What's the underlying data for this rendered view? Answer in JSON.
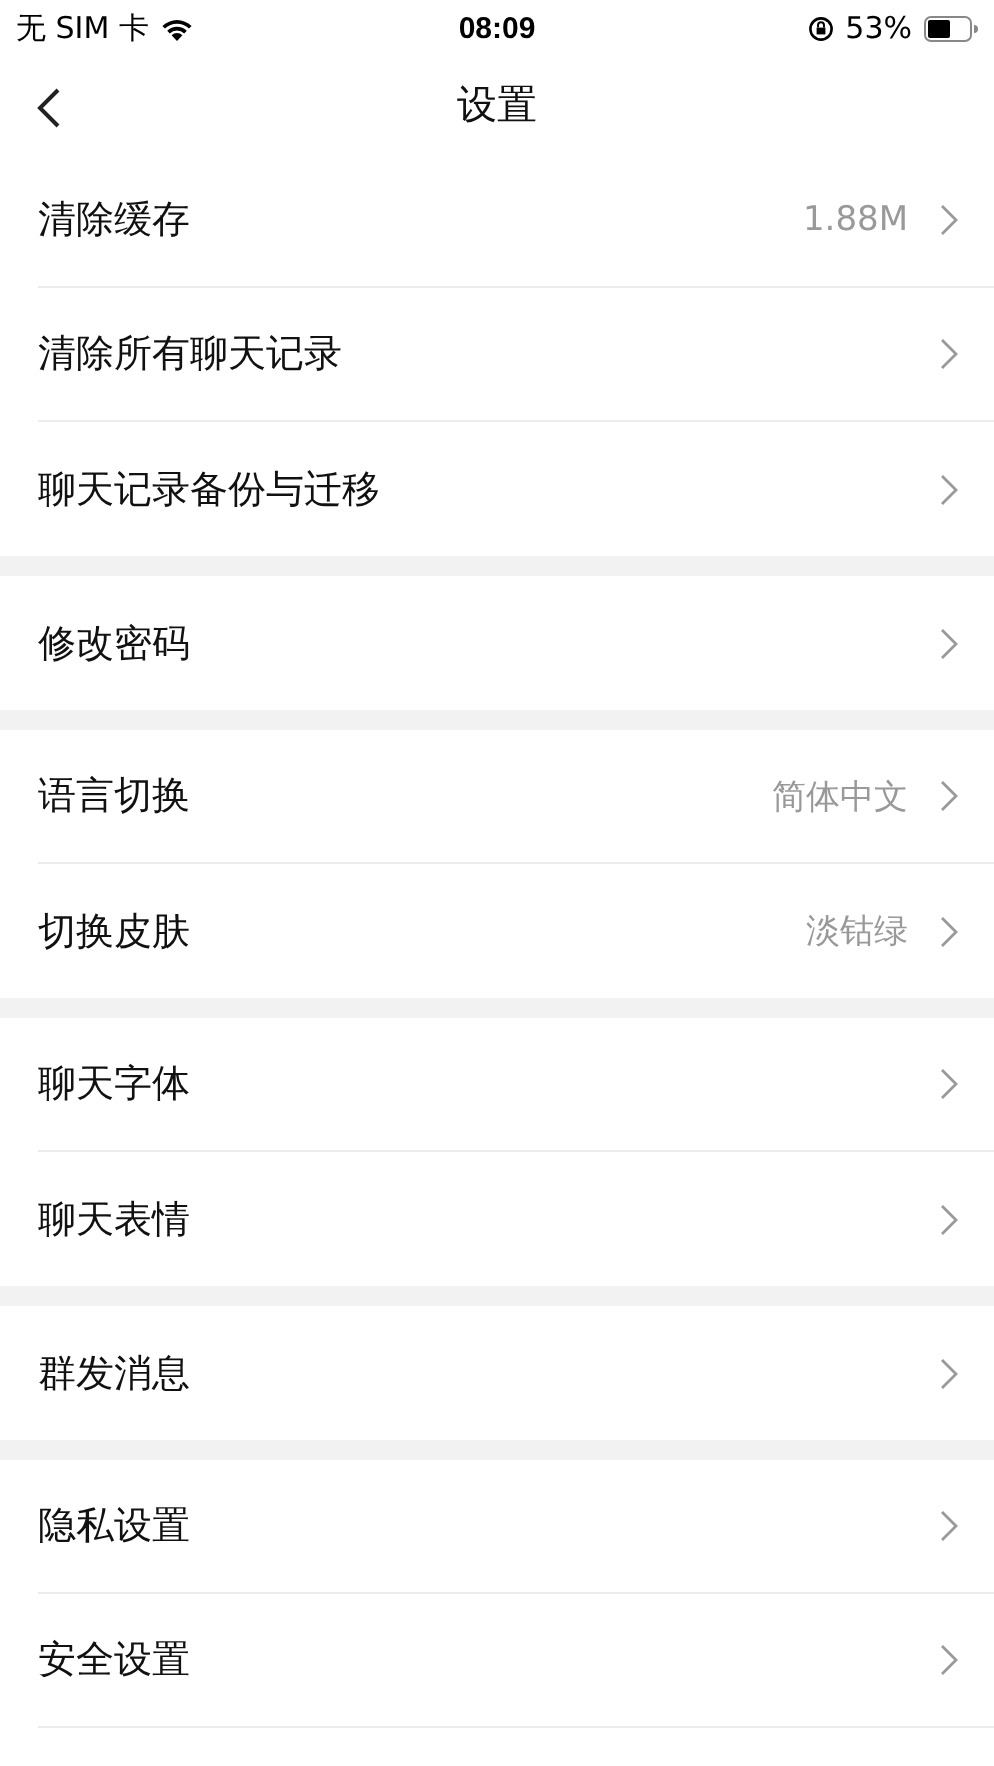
{
  "status_bar": {
    "carrier": "无 SIM 卡",
    "time": "08:09",
    "battery": "53%"
  },
  "nav": {
    "title": "设置"
  },
  "sections": [
    {
      "items": [
        {
          "label": "清除缓存",
          "value": "1.88M"
        },
        {
          "label": "清除所有聊天记录"
        },
        {
          "label": "聊天记录备份与迁移"
        }
      ]
    },
    {
      "items": [
        {
          "label": "修改密码"
        }
      ]
    },
    {
      "items": [
        {
          "label": "语言切换",
          "value": "简体中文"
        },
        {
          "label": "切换皮肤",
          "value": "淡钴绿"
        }
      ]
    },
    {
      "items": [
        {
          "label": "聊天字体"
        },
        {
          "label": "聊天表情"
        }
      ]
    },
    {
      "items": [
        {
          "label": "群发消息"
        }
      ]
    },
    {
      "items": [
        {
          "label": "隐私设置"
        },
        {
          "label": "安全设置"
        }
      ]
    }
  ]
}
